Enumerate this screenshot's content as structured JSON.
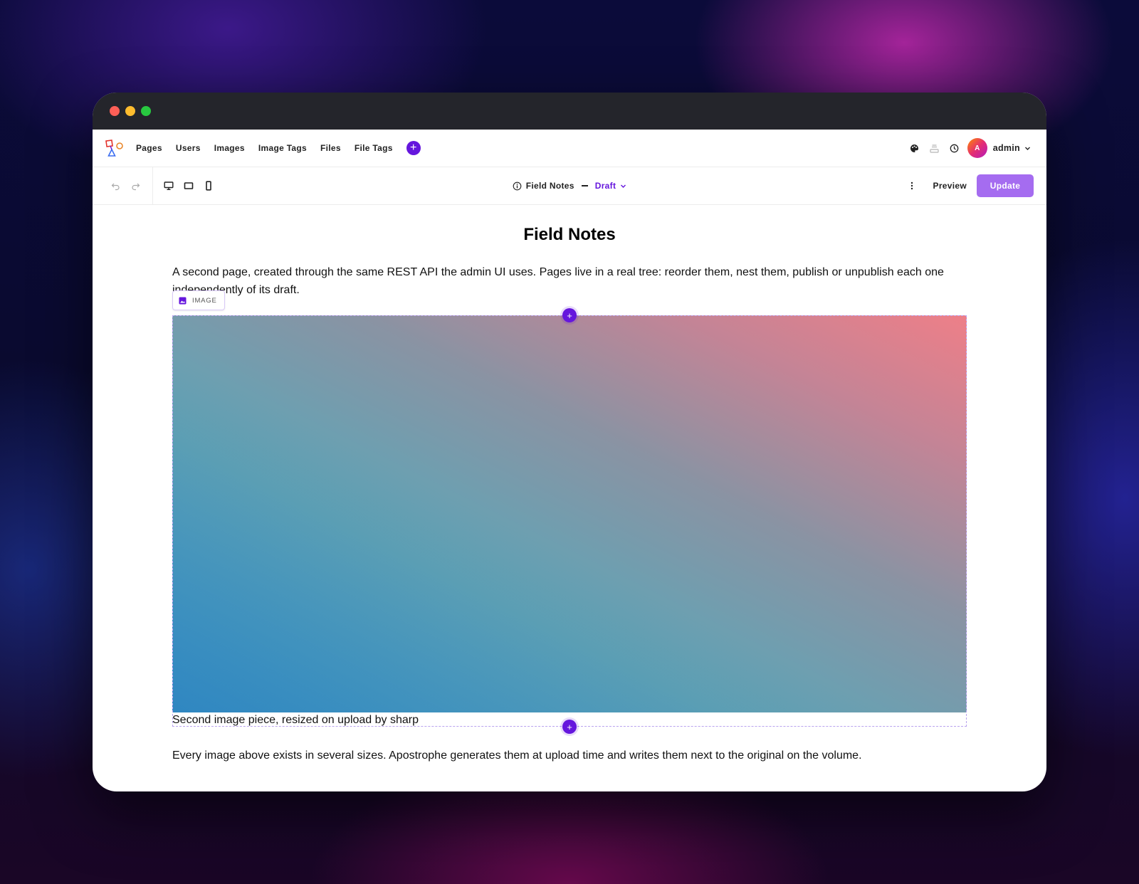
{
  "nav": {
    "items": [
      "Pages",
      "Users",
      "Images",
      "Image Tags",
      "Files",
      "File Tags"
    ],
    "add_symbol": "+",
    "user": {
      "initial": "A",
      "name": "admin"
    }
  },
  "toolbar": {
    "doc_title": "Field Notes",
    "status": "Draft",
    "preview_label": "Preview",
    "update_label": "Update"
  },
  "page": {
    "title": "Field Notes",
    "intro": "A second page, created through the same REST API the admin UI uses. Pages live in a real tree: reorder them, nest them, publish or unpublish each one independently of its draft.",
    "widget_label": "IMAGE",
    "image_caption": "Second image piece, resized on upload by sharp",
    "outro": "Every image above exists in several sizes. Apostrophe generates them at upload time and writes them next to the original on the volume.",
    "add_symbol": "+"
  },
  "colors": {
    "accent": "#6516dd",
    "update_button": "#a56cf0",
    "titlebar": "#24252b"
  },
  "icons": [
    "undo-icon",
    "redo-icon",
    "desktop-icon",
    "tablet-icon",
    "mobile-icon",
    "info-icon",
    "chevron-down-icon",
    "kebab-icon",
    "palette-icon",
    "archive-icon",
    "clock-icon",
    "image-icon"
  ]
}
